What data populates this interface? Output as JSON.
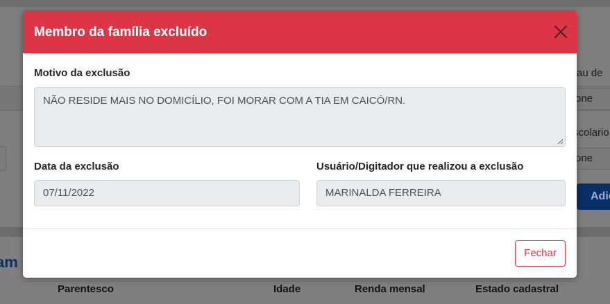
{
  "background": {
    "right_labels": [
      {
        "text": "rau de"
      },
      {
        "text": "scolario"
      }
    ],
    "right_selects": [
      "one",
      "one"
    ],
    "add_button_label": "Adic",
    "section_heading": "am",
    "table_columns": [
      "Parentesco",
      "Idade",
      "Renda mensal",
      "Estado cadastral"
    ]
  },
  "modal": {
    "title": "Membro da família excluído",
    "header_color": "#dc3545",
    "close_icon": "close-icon",
    "reason_label": "Motivo da exclusão",
    "reason_value": "NÃO RESIDE MAIS NO DOMICÍLIO, FOI MORAR COM A TIA EM CAICÓ/RN.",
    "date_label": "Data da exclusão",
    "date_value": "07/11/2022",
    "user_label": "Usuário/Digitador que realizou a exclusão",
    "user_value": "MARINALDA FERREIRA",
    "footer_button_label": "Fechar"
  }
}
